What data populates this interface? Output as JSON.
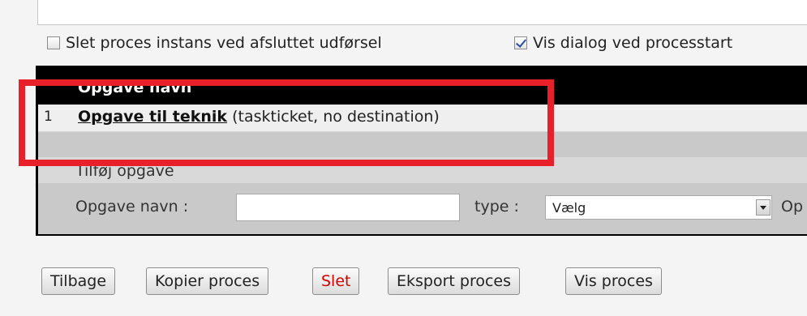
{
  "options": {
    "delete_instance_label": "Slet proces instans ved afsluttet udførsel",
    "delete_instance_checked": false,
    "show_dialog_label": "Vis dialog ved processtart",
    "show_dialog_checked": true
  },
  "task_table": {
    "header": "Opgave navn",
    "rows": [
      {
        "number": "1",
        "task_name": "Opgave til teknik",
        "detail": "(taskticket, no destination)"
      }
    ]
  },
  "add_task": {
    "title": "Tilføj opgave",
    "name_label": "Opgave navn :",
    "name_value": "",
    "type_label": "type :",
    "type_value": "Vælg",
    "trailing_label": "Op"
  },
  "buttons": {
    "back": "Tilbage",
    "copy": "Kopier proces",
    "delete": "Slet",
    "export": "Eksport proces",
    "show": "Vis proces"
  },
  "colors": {
    "highlight": "#e8202a",
    "delete_text": "#d40000",
    "header_bg": "#000000"
  }
}
